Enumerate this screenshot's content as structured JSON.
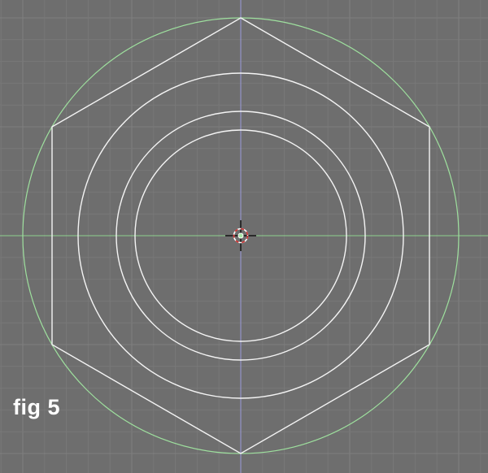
{
  "figure": {
    "label": "fig 5"
  },
  "colors": {
    "background": "#6e6e6e",
    "grid_minor": "#787878",
    "grid_major": "#7f7f7f",
    "x_axis": "#8fd08f",
    "y_axis": "#9a9ad8",
    "wire": "#f4f4f4",
    "guide_circle": "#9ee09e",
    "cursor": "#000000",
    "object_origin": "#a8e8a8"
  }
}
